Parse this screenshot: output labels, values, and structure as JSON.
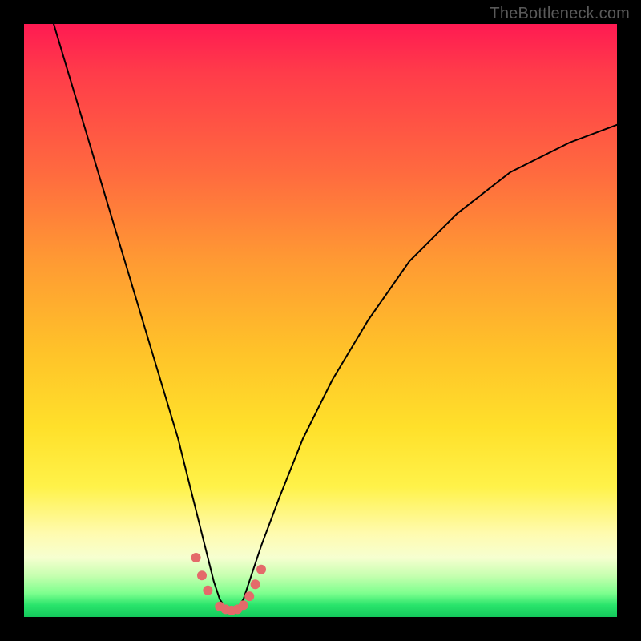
{
  "watermark": "TheBottleneck.com",
  "chart_data": {
    "type": "line",
    "title": "",
    "xlabel": "",
    "ylabel": "",
    "xlim": [
      0,
      100
    ],
    "ylim": [
      0,
      100
    ],
    "series": [
      {
        "name": "bottleneck-curve",
        "x": [
          5,
          8,
          11,
          14,
          17,
          20,
          23,
          26,
          28,
          30,
          31,
          32,
          33,
          34,
          35,
          36,
          37,
          38,
          40,
          43,
          47,
          52,
          58,
          65,
          73,
          82,
          92,
          100
        ],
        "values": [
          100,
          90,
          80,
          70,
          60,
          50,
          40,
          30,
          22,
          14,
          10,
          6,
          3,
          1.5,
          1,
          1.5,
          3,
          6,
          12,
          20,
          30,
          40,
          50,
          60,
          68,
          75,
          80,
          83
        ]
      }
    ],
    "markers": {
      "name": "highlight-dots",
      "color": "#e46a6a",
      "x": [
        29,
        30,
        31,
        33,
        34,
        35,
        36,
        37,
        38,
        39,
        40
      ],
      "values": [
        10,
        7,
        4.5,
        1.8,
        1.3,
        1.1,
        1.3,
        2.0,
        3.5,
        5.5,
        8
      ]
    },
    "gradient_stops": [
      {
        "pos": 0,
        "color": "#ff1a52"
      },
      {
        "pos": 25,
        "color": "#ff6a3f"
      },
      {
        "pos": 55,
        "color": "#ffc229"
      },
      {
        "pos": 78,
        "color": "#fff249"
      },
      {
        "pos": 90,
        "color": "#f6ffd0"
      },
      {
        "pos": 100,
        "color": "#14c95c"
      }
    ]
  }
}
